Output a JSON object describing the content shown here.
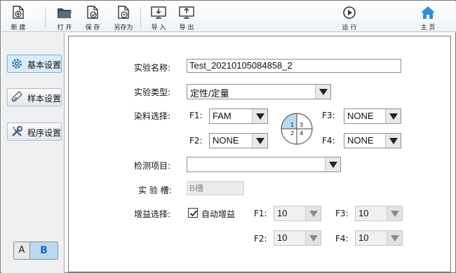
{
  "toolbar": {
    "new_label": "新 建",
    "open_label": "打 开",
    "save_label": "保 存",
    "saveas_label": "另存为",
    "import_label": "导 入",
    "export_label": "导 出",
    "run_label": "运 行",
    "home_label": "主 页"
  },
  "sidebar": {
    "basic_settings": "基本设置",
    "sample_settings": "样本设置",
    "program_settings": "程序设置",
    "toggle_a": "A",
    "toggle_b": "B"
  },
  "form": {
    "exp_name_label": "实验名称:",
    "exp_name_value": "Test_20210105084858_2",
    "exp_type_label": "实验类型:",
    "exp_type_value": "定性/定量",
    "dye_label": "染料选择:",
    "f1_label": "F1:",
    "f1_value": "FAM",
    "f2_label": "F2:",
    "f2_value": "NONE",
    "f3_label": "F3:",
    "f3_value": "NONE",
    "f4_label": "F4:",
    "f4_value": "NONE",
    "plate_q1": "1",
    "plate_q2": "2",
    "plate_q3": "3",
    "plate_q4": "4",
    "test_item_label": "检测项目:",
    "test_item_value": "",
    "slot_label": "实 验 槽:",
    "slot_value": "B槽",
    "gain_label": "增益选择:",
    "auto_gain_label": "自动增益",
    "auto_gain_checked": true,
    "gain_f1_label": "F1:",
    "gain_f1_value": "10",
    "gain_f2_label": "F2:",
    "gain_f2_value": "10",
    "gain_f3_label": "F3:",
    "gain_f3_value": "10",
    "gain_f4_label": "F4:",
    "gain_f4_value": "10"
  },
  "colors": {
    "accent": "#1a73c4",
    "home": "#2e8fd6",
    "active_nav": "#d9ecfa",
    "plate_selected": "#b9d9f3"
  }
}
